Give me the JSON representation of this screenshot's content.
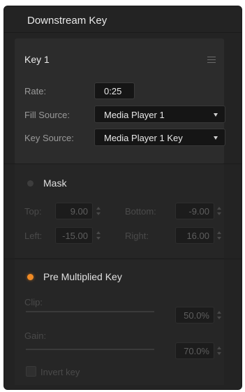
{
  "panel": {
    "title": "Downstream Key"
  },
  "key1": {
    "title": "Key 1",
    "menu_icon": "hamburger-menu-icon",
    "rate_label": "Rate:",
    "rate_value": "0:25",
    "fill_source_label": "Fill Source:",
    "fill_source_value": "Media Player 1",
    "key_source_label": "Key Source:",
    "key_source_value": "Media Player 1 Key"
  },
  "mask": {
    "label": "Mask",
    "enabled": false,
    "top_label": "Top:",
    "top_value": "9.00",
    "bottom_label": "Bottom:",
    "bottom_value": "-9.00",
    "left_label": "Left:",
    "left_value": "-15.00",
    "right_label": "Right:",
    "right_value": "16.00"
  },
  "pre_multiplied_key": {
    "label": "Pre Multiplied Key",
    "enabled": true,
    "accent_color": "#f08a24",
    "clip_label": "Clip:",
    "clip_value": "50.0%",
    "gain_label": "Gain:",
    "gain_value": "70.0%",
    "invert_key_label": "Invert key",
    "invert_key_checked": false
  }
}
